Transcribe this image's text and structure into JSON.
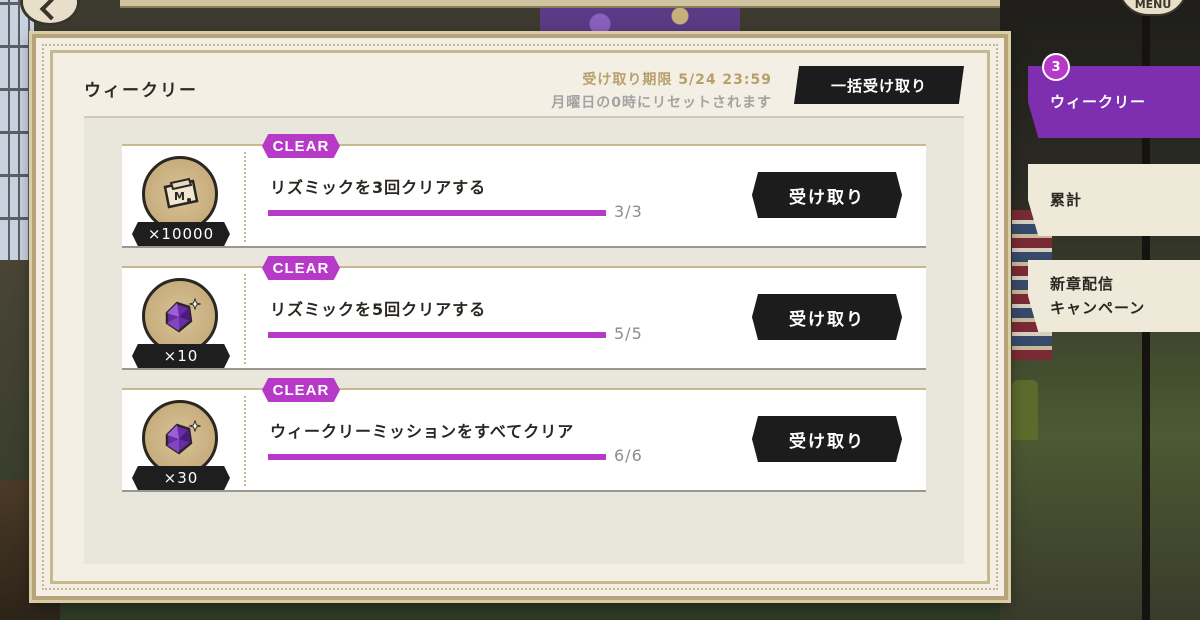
{
  "top_menu_label": "MENU",
  "panel": {
    "title": "ウィークリー",
    "deadline": "受け取り期限 5/24 23:59",
    "reset_note": "月曜日の0時にリセットされます",
    "bulk_claim_label": "一括受け取り"
  },
  "missions": [
    {
      "badge": "CLEAR",
      "reward_icon": "money-ticket-icon",
      "reward_quantity": "×10000",
      "title": "リズミックを3回クリアする",
      "progress_text": "3/3",
      "progress_fraction": 1.0,
      "claim_label": "受け取り"
    },
    {
      "badge": "CLEAR",
      "reward_icon": "purple-gem-icon",
      "reward_quantity": "×10",
      "title": "リズミックを5回クリアする",
      "progress_text": "5/5",
      "progress_fraction": 1.0,
      "claim_label": "受け取り"
    },
    {
      "badge": "CLEAR",
      "reward_icon": "purple-gem-icon",
      "reward_quantity": "×30",
      "title": "ウィークリーミッションをすべてクリア",
      "progress_text": "6/6",
      "progress_fraction": 1.0,
      "claim_label": "受け取り"
    }
  ],
  "tabs": [
    {
      "label": "ウィークリー",
      "active": true,
      "count": "3"
    },
    {
      "label": "累計",
      "active": false
    },
    {
      "label_line1": "新章配信",
      "label_line2": "キャンペーン",
      "active": false
    }
  ],
  "colors": {
    "accent_purple": "#b63ac7",
    "active_tab": "#7d2fb0",
    "button_dark": "#1c1c1c",
    "panel_bg": "#f3efe4",
    "deadline_gold": "#b7a06c"
  }
}
